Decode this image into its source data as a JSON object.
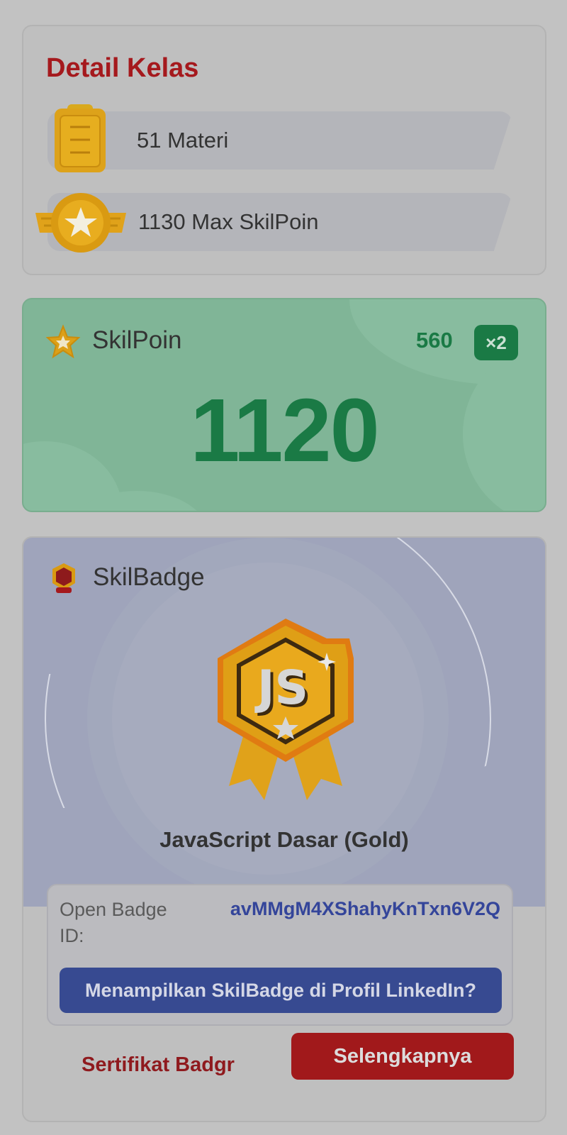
{
  "detail": {
    "title": "Detail Kelas",
    "materials": "51 Materi",
    "max_points": "1130 Max SkilPoin",
    "icons": [
      "clipboard-icon",
      "medal-icon"
    ]
  },
  "points": {
    "label": "SkilPoin",
    "base": "560",
    "multiplier": "×2",
    "total": "1120",
    "icon": "star-icon",
    "accent": "#1a7a45"
  },
  "badge": {
    "label": "SkilBadge",
    "name": "JavaScript Dasar (Gold)",
    "art_text": "JS",
    "open_badge_label": "Open Badge ID:",
    "open_badge_id": "avMMgM4XShahyKnTxn6V2Q",
    "linkedin_button": "Menampilkan SkilBadge di Profil LinkedIn?",
    "certificate_link": "Sertifikat Badgr",
    "more_button": "Selengkapnya",
    "icons": [
      "badge-small-icon",
      "js-gold-badge-icon"
    ]
  },
  "colors": {
    "brand_red": "#a5191d",
    "linkedin_blue": "#374a91",
    "points_green": "#80b597"
  }
}
